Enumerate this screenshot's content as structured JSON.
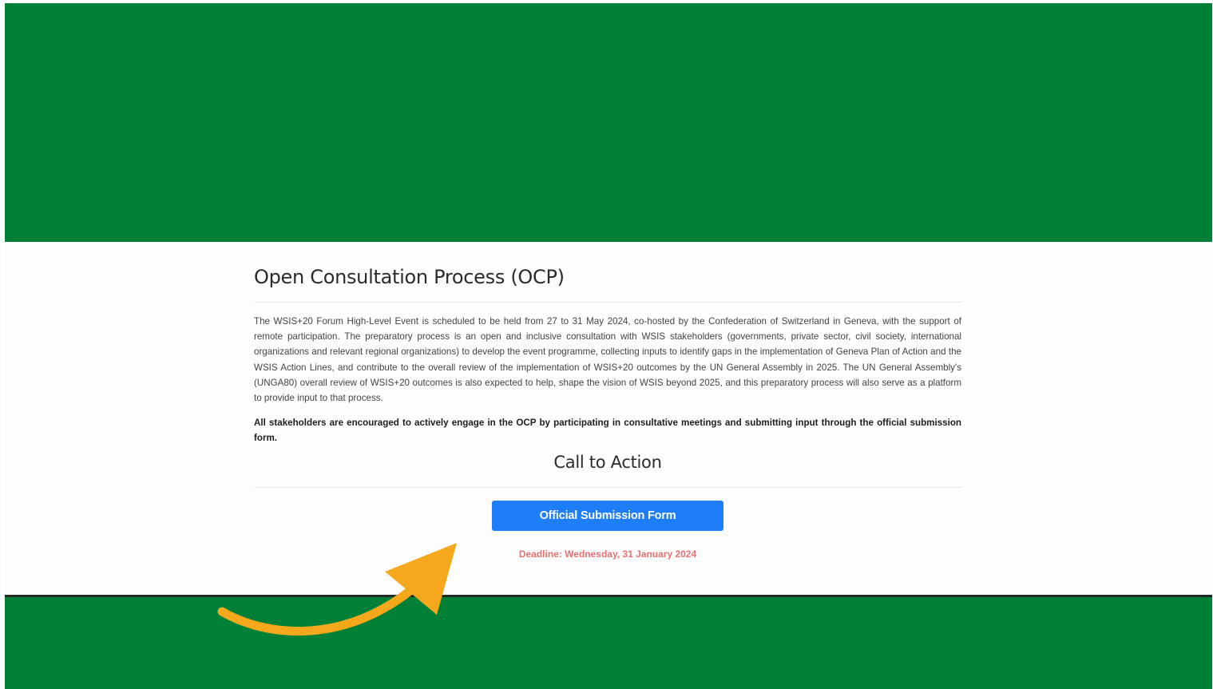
{
  "ocp": {
    "title": "Open Consultation Process (OCP)",
    "intro": "The WSIS+20 Forum High-Level Event is scheduled to be held from 27 to 31 May 2024, co-hosted by the Confederation of Switzerland in Geneva, with the support of remote participation. The preparatory process is an open and inclusive consultation with WSIS stakeholders (governments, private sector, civil society, international organizations and relevant regional organizations) to develop the event programme, collecting inputs to identify gaps in the implementation of Geneva Plan of Action and the WSIS Action Lines, and contribute to the overall review of the implementation of WSIS+20 outcomes by the UN General Assembly in 2025. The UN General Assembly's (UNGA80) overall review of WSIS+20 outcomes is also expected to help, shape the vision of WSIS beyond 2025, and this preparatory process will also serve as a platform to provide input to that process.",
    "notice": "All stakeholders are encouraged to actively engage in the OCP by participating in consultative meetings and submitting input through the official submission form."
  },
  "call_to_action": {
    "title": "Call to Action",
    "button_label": "Official Submission Form",
    "deadline": "Deadline: Wednesday, 31 January 2024"
  },
  "colors": {
    "band": "#008036",
    "button": "#1e7ef7",
    "deadline": "#e87171",
    "arrow": "#f5a81c"
  },
  "overlay": {
    "icon": "curved-arrow-icon"
  }
}
